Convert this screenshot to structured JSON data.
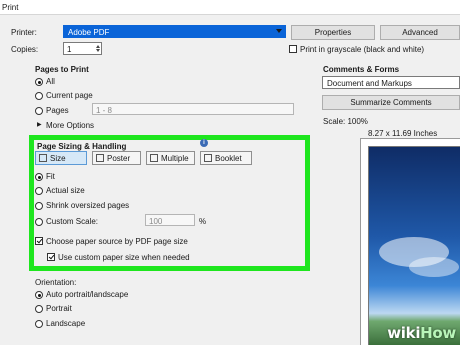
{
  "window": {
    "title": "Print"
  },
  "printer": {
    "label": "Printer:",
    "value": "Adobe PDF"
  },
  "copies": {
    "label": "Copies:",
    "value": "1"
  },
  "buttons": {
    "properties": "Properties",
    "advanced": "Advanced",
    "summarize": "Summarize Comments"
  },
  "grayscale": {
    "label": "Print in grayscale (black and white)",
    "checked": false
  },
  "pages_to_print": {
    "header": "Pages to Print",
    "all": "All",
    "current": "Current page",
    "pages": "Pages",
    "pages_value": "1 - 8",
    "more_options": "More Options"
  },
  "sizing": {
    "header": "Page Sizing & Handling",
    "info_glyph": "i",
    "tabs": [
      "Size",
      "Poster",
      "Multiple",
      "Booklet"
    ],
    "options": {
      "fit": "Fit",
      "actual": "Actual size",
      "shrink": "Shrink oversized pages",
      "custom": "Custom Scale:",
      "custom_value": "100",
      "custom_unit": "%"
    },
    "paper_source": "Choose paper source by PDF page size",
    "custom_paper": "Use custom paper size when needed"
  },
  "orientation": {
    "header": "Orientation:",
    "auto": "Auto portrait/landscape",
    "portrait": "Portrait",
    "landscape": "Landscape"
  },
  "comments_forms": {
    "header": "Comments & Forms",
    "value": "Document and Markups",
    "scale": "Scale: 100%",
    "page_size": "8.27 x 11.69 Inches"
  },
  "watermark": {
    "wiki": "wiki",
    "how": "How"
  },
  "colors": {
    "highlight": "#1ee61e",
    "selection": "#0a64d8"
  }
}
